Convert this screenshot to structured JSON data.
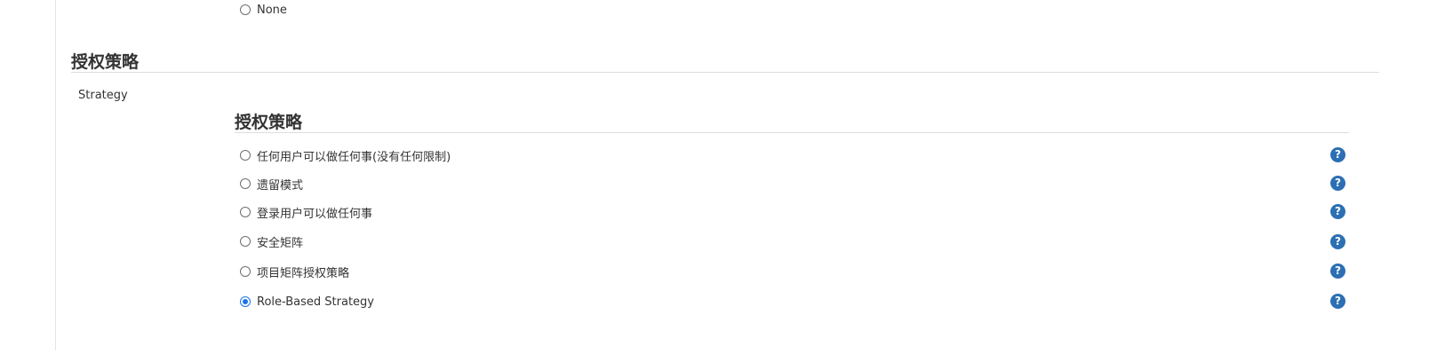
{
  "security_realm": {
    "options": [
      {
        "label": "None",
        "selected": false
      }
    ]
  },
  "authorization": {
    "section_title": "授权策略",
    "field_label": "Strategy",
    "dropdown_title": "授权策略",
    "help_icon_glyph": "?",
    "options": [
      {
        "label": "任何用户可以做任何事(没有任何限制)",
        "selected": false
      },
      {
        "label": "遗留模式",
        "selected": false
      },
      {
        "label": "登录用户可以做任何事",
        "selected": false
      },
      {
        "label": "安全矩阵",
        "selected": false
      },
      {
        "label": "项目矩阵授权策略",
        "selected": false
      },
      {
        "label": "Role-Based Strategy",
        "selected": true
      }
    ]
  },
  "colors": {
    "accent": "#1a73e8",
    "help_icon": "#2c6fb4"
  }
}
